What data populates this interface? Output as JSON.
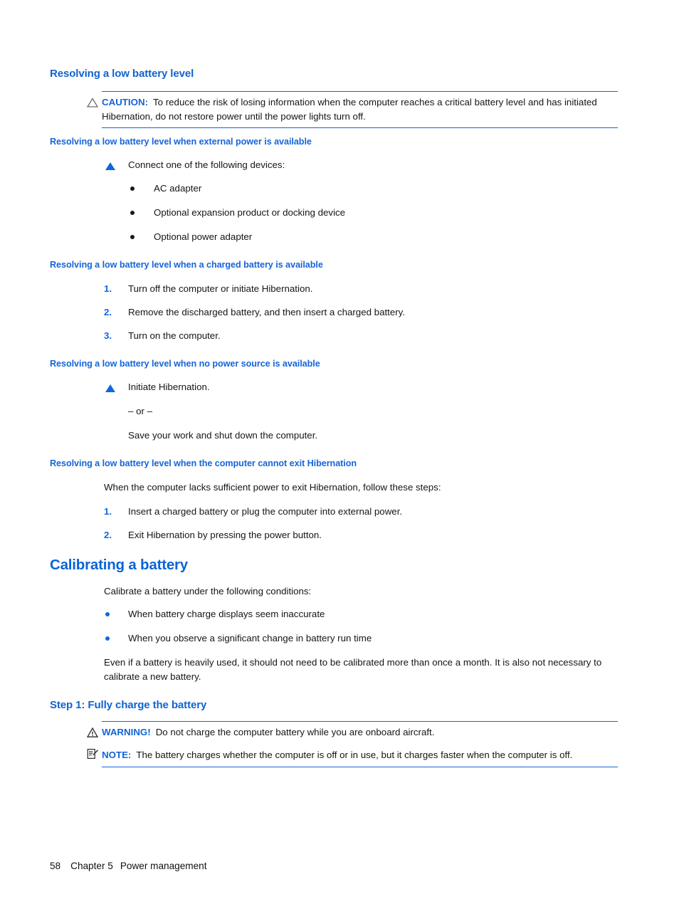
{
  "page": {
    "section_heading": "Resolving a low battery level",
    "caution": {
      "icon": "caution-triangle-icon",
      "label": "CAUTION:",
      "text": "To reduce the risk of losing information when the computer reaches a critical battery level and has initiated Hibernation, do not restore power until the power lights turn off."
    },
    "subsection_external_power": {
      "heading": "Resolving a low battery level when external power is available",
      "lead": "Connect one of the following devices:",
      "items": [
        "AC adapter",
        "Optional expansion product or docking device",
        "Optional power adapter"
      ]
    },
    "subsection_charged_battery": {
      "heading": "Resolving a low battery level when a charged battery is available",
      "steps": [
        {
          "num": "1.",
          "text": "Turn off the computer or initiate Hibernation."
        },
        {
          "num": "2.",
          "text": "Remove the discharged battery, and then insert a charged battery."
        },
        {
          "num": "3.",
          "text": "Turn on the computer."
        }
      ]
    },
    "subsection_no_power": {
      "heading": "Resolving a low battery level when no power source is available",
      "action": "Initiate Hibernation.",
      "or_text": "– or –",
      "alternative": "Save your work and shut down the computer."
    },
    "subsection_cannot_exit": {
      "heading": "Resolving a low battery level when the computer cannot exit Hibernation",
      "lead": "When the computer lacks sufficient power to exit Hibernation, follow these steps:",
      "steps": [
        {
          "num": "1.",
          "text": "Insert a charged battery or plug the computer into external power."
        },
        {
          "num": "2.",
          "text": "Exit Hibernation by pressing the power button."
        }
      ]
    },
    "calibrating": {
      "heading": "Calibrating a battery",
      "lead": "Calibrate a battery under the following conditions:",
      "items": [
        "When battery charge displays seem inaccurate",
        "When you observe a significant change in battery run time"
      ],
      "note_paragraph": "Even if a battery is heavily used, it should not need to be calibrated more than once a month. It is also not necessary to calibrate a new battery."
    },
    "step1": {
      "heading": "Step 1: Fully charge the battery",
      "warning": {
        "icon": "warning-triangle-icon",
        "label": "WARNING!",
        "text": "Do not charge the computer battery while you are onboard aircraft."
      },
      "note": {
        "icon": "note-pencil-icon",
        "label": "NOTE:",
        "text": "The battery charges whether the computer is off or in use, but it charges faster when the computer is off."
      }
    },
    "footer": {
      "page_number": "58",
      "chapter": "Chapter 5",
      "chapter_title": "Power management"
    },
    "colors": {
      "heading_blue": "#1063d0",
      "accent_blue": "#1166e0",
      "rule_blue": "#1265d4",
      "body_black": "#151515"
    }
  }
}
